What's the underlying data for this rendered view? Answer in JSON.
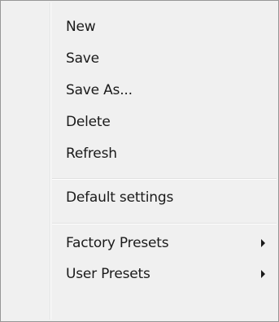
{
  "menu": {
    "items": [
      {
        "label": "New"
      },
      {
        "label": "Save"
      },
      {
        "label": "Save As..."
      },
      {
        "label": "Delete"
      },
      {
        "label": "Refresh"
      },
      {
        "label": "Default settings"
      },
      {
        "label": "Factory Presets",
        "submenu": true
      },
      {
        "label": "User Presets",
        "submenu": true
      }
    ]
  }
}
